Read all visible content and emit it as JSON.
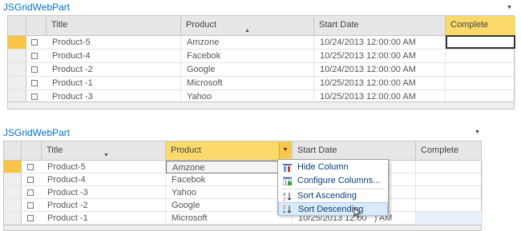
{
  "top": {
    "title": "JSGridWebPart",
    "menu_icon": "triangle-down-icon",
    "columns": [
      "Title",
      "Product",
      "Start Date",
      "Complete"
    ],
    "sort_icon": "sort-up-arrow-icon",
    "rows": [
      {
        "title": "Product-5",
        "product": "Amzone",
        "start": "10/24/2013 12:00:00 AM",
        "complete": ""
      },
      {
        "title": "Product-4",
        "product": "Facebok",
        "start": "10/25/2013 12:00:00 AM",
        "complete": ""
      },
      {
        "title": "Product -2",
        "product": "Google",
        "start": "10/24/2013 12:00:00 AM",
        "complete": ""
      },
      {
        "title": "Product -1",
        "product": "Microsoft",
        "start": "10/25/2013 12:00:00 AM",
        "complete": ""
      },
      {
        "title": "Product -3",
        "product": "Yahoo",
        "start": "10/25/2013 12:00:00 AM",
        "complete": ""
      }
    ]
  },
  "bottom": {
    "title": "JSGridWebPart",
    "menu_icon": "triangle-down-icon",
    "columns": [
      "Title",
      "Product",
      "Start Date",
      "Complete"
    ],
    "rows": [
      {
        "title": "Product-5",
        "product": "Amzone",
        "start": "",
        "complete": ""
      },
      {
        "title": "Product-4",
        "product": "Facebok",
        "start": "",
        "complete": ""
      },
      {
        "title": "Product -3",
        "product": "Yahoo",
        "start": "",
        "complete": ""
      },
      {
        "title": "Product -2",
        "product": "Google",
        "start": "",
        "complete": ""
      },
      {
        "title": "Product -1",
        "product": "Microsoft",
        "start": "10/25/2013 12:00",
        "start_suffix": ") AM",
        "complete": ""
      }
    ],
    "context_menu": [
      {
        "label": "Hide Column",
        "icon": "hide-column-icon"
      },
      {
        "label": "Configure Columns...",
        "icon": "configure-columns-icon"
      },
      {
        "label": "Sort Ascending",
        "icon": "sort-ascending-icon"
      },
      {
        "label": "Sort Descending",
        "icon": "sort-descending-icon"
      }
    ]
  },
  "colors": {
    "link": "#0072c6",
    "header_bg": "#e7e7e7",
    "highlight": "#fbd96a",
    "selection": "#f9c546",
    "menu_text": "#0a3f7a",
    "menu_hover": "#dbeaf9"
  }
}
